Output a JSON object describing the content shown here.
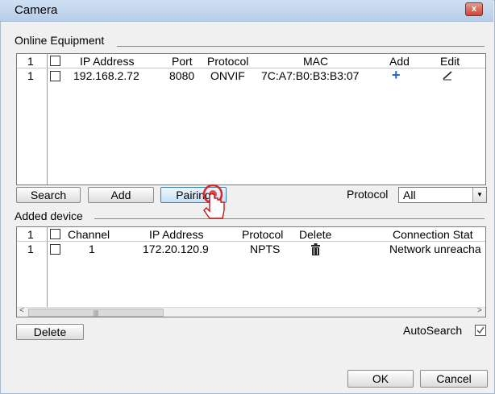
{
  "window": {
    "title": "Camera",
    "close_glyph": "x"
  },
  "online": {
    "section_label": "Online Equipment",
    "headers": {
      "num": "1",
      "ip": "IP Address",
      "port": "Port",
      "protocol": "Protocol",
      "mac": "MAC",
      "add": "Add",
      "edit": "Edit"
    },
    "rows": [
      {
        "num": "1",
        "ip": "192.168.2.72",
        "port": "8080",
        "protocol": "ONVIF",
        "mac": "7C:A7:B0:B3:B3:07",
        "add_icon": "plus-icon",
        "edit_icon": "pencil-icon"
      }
    ]
  },
  "toolbar": {
    "search_label": "Search",
    "add_label": "Add",
    "pairing_label": "Pairing",
    "protocol_label": "Protocol",
    "protocol_value": "All"
  },
  "added": {
    "section_label": "Added device",
    "headers": {
      "num": "1",
      "channel": "Channel",
      "ip": "IP Address",
      "protocol": "Protocol",
      "delete": "Delete",
      "status": "Connection Stat"
    },
    "rows": [
      {
        "num": "1",
        "channel": "1",
        "ip": "172.20.120.9",
        "protocol": "NPTS",
        "delete_icon": "trash-icon",
        "status": "Network unreacha"
      }
    ],
    "scroll_left": "<",
    "scroll_right": ">",
    "thumb_grip": "|||"
  },
  "bottom": {
    "delete_label": "Delete",
    "autosearch_label": "AutoSearch",
    "autosearch_checked": true,
    "ok_label": "OK",
    "cancel_label": "Cancel"
  },
  "colors": {
    "accent": "#2266cc",
    "title_bar": "#c4d8ef",
    "pointer_ring": "#e02424"
  }
}
